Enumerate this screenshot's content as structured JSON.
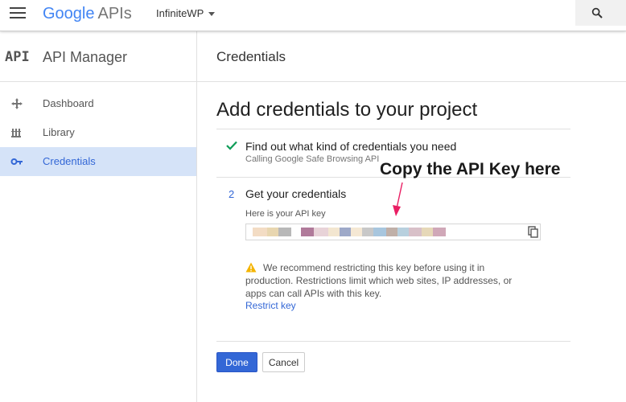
{
  "topbar": {
    "logo_google": "Google",
    "logo_apis": "APIs",
    "project_name": "InfiniteWP"
  },
  "sidebar": {
    "badge": "API",
    "title": "API Manager",
    "items": [
      {
        "label": "Dashboard",
        "icon": "dashboard-icon"
      },
      {
        "label": "Library",
        "icon": "library-icon"
      },
      {
        "label": "Credentials",
        "icon": "key-icon",
        "active": true
      }
    ]
  },
  "main": {
    "header_title": "Credentials",
    "page_title": "Add credentials to your project",
    "step1": {
      "title": "Find out what kind of credentials you need",
      "subtitle": "Calling Google Safe Browsing API"
    },
    "step2": {
      "number": "2",
      "title": "Get your credentials",
      "key_label": "Here is your API key"
    },
    "warning": "We recommend restricting this key before using it in production. Restrictions limit which web sites, IP addresses, or apps can call APIs with this key.",
    "restrict_link": "Restrict key",
    "done_label": "Done",
    "cancel_label": "Cancel"
  },
  "annotation": "Copy the API Key here",
  "colors": {
    "accent": "#3367d6",
    "active_bg": "#d5e3f8",
    "check": "#0f9d58",
    "warning": "#f4b400",
    "annotation_arrow": "#e91e63"
  }
}
